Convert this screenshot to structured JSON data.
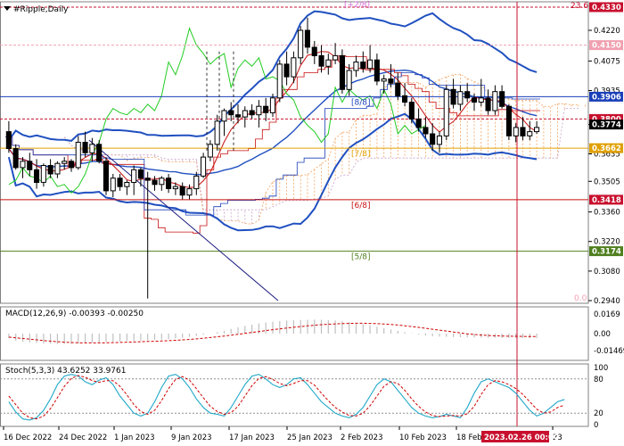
{
  "chart_data": {
    "type": "candlestick",
    "title": "#Ripple,Daily",
    "price_axis": {
      "min": 0.294,
      "max": 0.433,
      "ticks": [
        "0.4220",
        "0.4075",
        "0.3935",
        "0.3774",
        "0.3635",
        "0.3505",
        "0.3360",
        "0.3220",
        "0.3080",
        "0.2940"
      ]
    },
    "time_labels": [
      "16 Dec 2022",
      "24 Dec 2022",
      "1 Jan 2023",
      "9 Jan 2023",
      "17 Jan 2023",
      "25 Jan 2023",
      "2 Feb 2023",
      "10 Feb 2023",
      "18 Feb",
      "23"
    ],
    "cursor_label": "2023.02.26 00:00",
    "candles": [
      [
        0.374,
        0.379,
        0.364,
        0.366
      ],
      [
        0.366,
        0.368,
        0.356,
        0.357
      ],
      [
        0.357,
        0.362,
        0.352,
        0.36
      ],
      [
        0.36,
        0.364,
        0.353,
        0.356
      ],
      [
        0.356,
        0.361,
        0.347,
        0.35
      ],
      [
        0.35,
        0.359,
        0.348,
        0.358
      ],
      [
        0.358,
        0.361,
        0.352,
        0.354
      ],
      [
        0.354,
        0.36,
        0.352,
        0.359
      ],
      [
        0.359,
        0.362,
        0.356,
        0.36
      ],
      [
        0.36,
        0.361,
        0.355,
        0.357
      ],
      [
        0.357,
        0.372,
        0.356,
        0.369
      ],
      [
        0.369,
        0.374,
        0.362,
        0.364
      ],
      [
        0.364,
        0.371,
        0.36,
        0.368
      ],
      [
        0.368,
        0.37,
        0.359,
        0.36
      ],
      [
        0.36,
        0.362,
        0.344,
        0.346
      ],
      [
        0.346,
        0.354,
        0.343,
        0.352
      ],
      [
        0.352,
        0.354,
        0.346,
        0.348
      ],
      [
        0.348,
        0.351,
        0.344,
        0.35
      ],
      [
        0.35,
        0.358,
        0.344,
        0.356
      ],
      [
        0.356,
        0.357,
        0.348,
        0.352
      ],
      [
        0.352,
        0.355,
        0.295,
        0.351
      ],
      [
        0.351,
        0.353,
        0.346,
        0.349
      ],
      [
        0.349,
        0.353,
        0.346,
        0.352
      ],
      [
        0.352,
        0.354,
        0.345,
        0.347
      ],
      [
        0.347,
        0.35,
        0.344,
        0.348
      ],
      [
        0.348,
        0.35,
        0.342,
        0.344
      ],
      [
        0.344,
        0.349,
        0.342,
        0.347
      ],
      [
        0.347,
        0.355,
        0.344,
        0.353
      ],
      [
        0.353,
        0.364,
        0.352,
        0.362
      ],
      [
        0.362,
        0.37,
        0.36,
        0.368
      ],
      [
        0.368,
        0.382,
        0.365,
        0.379
      ],
      [
        0.379,
        0.385,
        0.372,
        0.384
      ],
      [
        0.384,
        0.388,
        0.379,
        0.382
      ],
      [
        0.382,
        0.387,
        0.378,
        0.381
      ],
      [
        0.381,
        0.386,
        0.376,
        0.384
      ],
      [
        0.384,
        0.387,
        0.38,
        0.382
      ],
      [
        0.382,
        0.389,
        0.376,
        0.386
      ],
      [
        0.386,
        0.39,
        0.379,
        0.383
      ],
      [
        0.383,
        0.392,
        0.381,
        0.39
      ],
      [
        0.39,
        0.408,
        0.388,
        0.406
      ],
      [
        0.406,
        0.412,
        0.396,
        0.4
      ],
      [
        0.4,
        0.412,
        0.397,
        0.409
      ],
      [
        0.409,
        0.424,
        0.406,
        0.422
      ],
      [
        0.422,
        0.428,
        0.411,
        0.414
      ],
      [
        0.414,
        0.417,
        0.406,
        0.41
      ],
      [
        0.41,
        0.415,
        0.402,
        0.405
      ],
      [
        0.405,
        0.411,
        0.401,
        0.408
      ],
      [
        0.408,
        0.416,
        0.406,
        0.41
      ],
      [
        0.41,
        0.413,
        0.392,
        0.394
      ],
      [
        0.394,
        0.406,
        0.391,
        0.403
      ],
      [
        0.403,
        0.41,
        0.4,
        0.407
      ],
      [
        0.407,
        0.412,
        0.402,
        0.404
      ],
      [
        0.404,
        0.415,
        0.402,
        0.408
      ],
      [
        0.408,
        0.411,
        0.396,
        0.398
      ],
      [
        0.398,
        0.401,
        0.392,
        0.399
      ],
      [
        0.399,
        0.406,
        0.395,
        0.397
      ],
      [
        0.397,
        0.402,
        0.389,
        0.391
      ],
      [
        0.391,
        0.397,
        0.386,
        0.388
      ],
      [
        0.388,
        0.39,
        0.378,
        0.38
      ],
      [
        0.38,
        0.385,
        0.374,
        0.376
      ],
      [
        0.376,
        0.381,
        0.371,
        0.373
      ],
      [
        0.373,
        0.378,
        0.365,
        0.368
      ],
      [
        0.368,
        0.374,
        0.364,
        0.372
      ],
      [
        0.372,
        0.396,
        0.37,
        0.394
      ],
      [
        0.394,
        0.399,
        0.385,
        0.387
      ],
      [
        0.387,
        0.396,
        0.384,
        0.393
      ],
      [
        0.393,
        0.397,
        0.388,
        0.39
      ],
      [
        0.39,
        0.392,
        0.384,
        0.388
      ],
      [
        0.388,
        0.399,
        0.386,
        0.39
      ],
      [
        0.39,
        0.394,
        0.382,
        0.384
      ],
      [
        0.384,
        0.396,
        0.382,
        0.393
      ],
      [
        0.393,
        0.396,
        0.385,
        0.386
      ],
      [
        0.386,
        0.387,
        0.37,
        0.372
      ],
      [
        0.372,
        0.378,
        0.369,
        0.376
      ],
      [
        0.376,
        0.381,
        0.37,
        0.372
      ],
      [
        0.372,
        0.379,
        0.37,
        0.374
      ],
      [
        0.374,
        0.379,
        0.373,
        0.376
      ]
    ],
    "levels": [
      {
        "label": "[8/8]",
        "value": 0.3906,
        "color": "#1a3fb8"
      },
      {
        "label": "[7/8]",
        "value": 0.3662,
        "color": "#e0a000"
      },
      {
        "label": "[6/8]",
        "value": 0.3418,
        "color": "#c81010"
      },
      {
        "label": "[5/8]",
        "value": 0.3174,
        "color": "#4f7f1f"
      }
    ],
    "price_tags": [
      {
        "value": 0.433,
        "text": "0.4330",
        "color": "#c8102e"
      },
      {
        "value": 0.415,
        "text": "0.4150",
        "color": "#f0a0b0"
      },
      {
        "value": 0.3906,
        "text": "0.3906",
        "color": "#1a3fb8"
      },
      {
        "value": 0.38,
        "text": "0.3800",
        "color": "#c8102e"
      },
      {
        "value": 0.3774,
        "text": "0.3774",
        "color": "#000000"
      },
      {
        "value": 0.3662,
        "text": "0.3662",
        "color": "#e0a000"
      },
      {
        "value": 0.3418,
        "text": "0.3418",
        "color": "#c8102e"
      },
      {
        "value": 0.3174,
        "text": "0.3174",
        "color": "#4f7f1f"
      }
    ],
    "top_note": "[+2/8]",
    "fib_top": "23.6",
    "fib_bottom": "0.0",
    "macd": {
      "label": "MACD(12,26,9) -0.00393 -0.00250",
      "ticks": [
        "0.0169",
        "0.00",
        "-0.01469"
      ],
      "range": [
        -0.02,
        0.02
      ],
      "hist": [
        -0.004,
        -0.006,
        -0.007,
        -0.0075,
        -0.008,
        -0.0085,
        -0.0088,
        -0.009,
        -0.009,
        -0.0088,
        -0.0085,
        -0.0082,
        -0.0078,
        -0.0075,
        -0.0072,
        -0.007,
        -0.0068,
        -0.0065,
        -0.0062,
        -0.006,
        -0.0058,
        -0.0055,
        -0.0052,
        -0.0048,
        -0.0042,
        -0.0036,
        -0.0028,
        -0.002,
        -0.001,
        0.0,
        0.0012,
        0.0025,
        0.004,
        0.0055,
        0.0068,
        0.0078,
        0.0088,
        0.0096,
        0.0102,
        0.0108,
        0.0112,
        0.0115,
        0.0118,
        0.0119,
        0.012,
        0.0119,
        0.0116,
        0.0112,
        0.0106,
        0.01,
        0.0092,
        0.0082,
        0.0072,
        0.006,
        0.0048,
        0.0036,
        0.0024,
        0.0012,
        0.0002,
        -0.0008,
        -0.0016,
        -0.0022,
        -0.0026,
        -0.0028,
        -0.003,
        -0.0031,
        -0.0032,
        -0.0033,
        -0.0034,
        -0.0035,
        -0.0036,
        -0.0037,
        -0.0038,
        -0.0038,
        -0.0039,
        -0.0039,
        -0.0039
      ],
      "signal": [
        -0.003,
        -0.0036,
        -0.0042,
        -0.0048,
        -0.0054,
        -0.006,
        -0.0065,
        -0.007,
        -0.0074,
        -0.0077,
        -0.0079,
        -0.008,
        -0.008,
        -0.008,
        -0.0079,
        -0.0078,
        -0.0076,
        -0.0074,
        -0.0072,
        -0.007,
        -0.0068,
        -0.0066,
        -0.0064,
        -0.0061,
        -0.0058,
        -0.0054,
        -0.005,
        -0.0045,
        -0.004,
        -0.0034,
        -0.0028,
        -0.0021,
        -0.0014,
        -0.0006,
        0.0002,
        0.001,
        0.0018,
        0.0026,
        0.0034,
        0.0041,
        0.0048,
        0.0055,
        0.0061,
        0.0067,
        0.0072,
        0.0077,
        0.0081,
        0.0084,
        0.0086,
        0.0088,
        0.0089,
        0.0089,
        0.0088,
        0.0086,
        0.0083,
        0.0079,
        0.0074,
        0.0068,
        0.0061,
        0.0054,
        0.0046,
        0.0038,
        0.003,
        0.0022,
        0.0014,
        0.0006,
        -0.0002,
        -0.0008,
        -0.0012,
        -0.0016,
        -0.0019,
        -0.0021,
        -0.0022,
        -0.0023,
        -0.0024,
        -0.0025,
        -0.0025
      ]
    },
    "stoch": {
      "label": "Stoch(5,3,3) 43.6252 33.9761",
      "ticks": [
        "100",
        "80",
        "20",
        "0"
      ],
      "range": [
        0,
        100
      ],
      "levels": [
        80,
        20
      ],
      "k": [
        40,
        22,
        10,
        8,
        12,
        25,
        45,
        70,
        85,
        88,
        85,
        75,
        70,
        78,
        82,
        70,
        50,
        35,
        20,
        15,
        20,
        40,
        65,
        85,
        88,
        80,
        65,
        45,
        30,
        20,
        18,
        15,
        30,
        50,
        70,
        85,
        88,
        80,
        70,
        65,
        70,
        80,
        82,
        70,
        55,
        40,
        30,
        20,
        15,
        12,
        18,
        30,
        50,
        70,
        80,
        75,
        60,
        45,
        30,
        20,
        15,
        12,
        14,
        18,
        15,
        12,
        30,
        55,
        75,
        80,
        75,
        70,
        65,
        55,
        40,
        25,
        15,
        20,
        30,
        40,
        44
      ],
      "d": [
        50,
        35,
        20,
        12,
        10,
        15,
        28,
        47,
        67,
        81,
        86,
        83,
        77,
        74,
        77,
        77,
        67,
        52,
        35,
        23,
        18,
        25,
        42,
        63,
        79,
        84,
        78,
        63,
        47,
        32,
        23,
        18,
        21,
        32,
        50,
        68,
        81,
        84,
        79,
        72,
        68,
        72,
        77,
        77,
        69,
        55,
        42,
        30,
        22,
        16,
        15,
        20,
        33,
        50,
        67,
        75,
        72,
        60,
        45,
        32,
        22,
        16,
        14,
        15,
        16,
        15,
        19,
        32,
        53,
        70,
        77,
        75,
        70,
        63,
        53,
        40,
        27,
        20,
        22,
        30,
        34
      ]
    }
  }
}
